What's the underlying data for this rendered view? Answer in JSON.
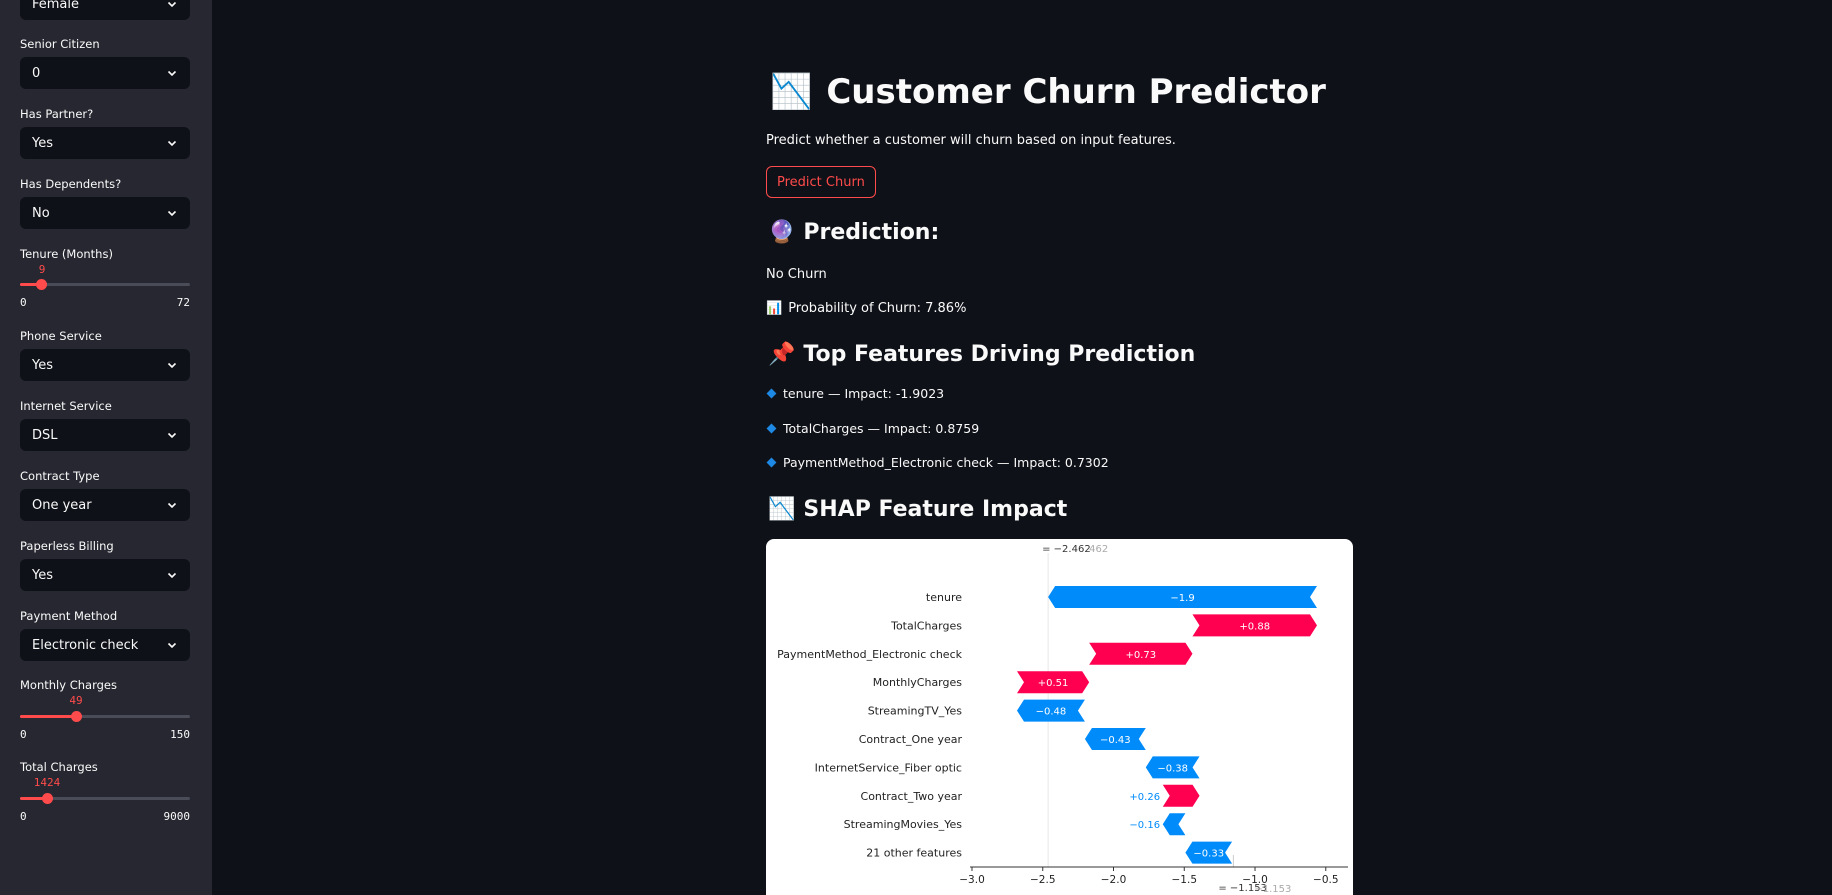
{
  "sidebar": {
    "gender_value": "Female",
    "senior": {
      "label": "Senior Citizen",
      "value": "0"
    },
    "partner": {
      "label": "Has Partner?",
      "value": "Yes"
    },
    "dependents": {
      "label": "Has Dependents?",
      "value": "No"
    },
    "tenure": {
      "label": "Tenure (Months)",
      "value": "9",
      "min": "0",
      "max": "72"
    },
    "phone": {
      "label": "Phone Service",
      "value": "Yes"
    },
    "internet": {
      "label": "Internet Service",
      "value": "DSL"
    },
    "contract": {
      "label": "Contract Type",
      "value": "One year"
    },
    "paperless": {
      "label": "Paperless Billing",
      "value": "Yes"
    },
    "payment": {
      "label": "Payment Method",
      "value": "Electronic check"
    },
    "monthly": {
      "label": "Monthly Charges",
      "value": "49",
      "min": "0",
      "max": "150"
    },
    "total": {
      "label": "Total Charges",
      "value": "1424",
      "min": "0",
      "max": "9000"
    }
  },
  "main": {
    "title_icon": "📉",
    "title": "Customer Churn Predictor",
    "subtitle": "Predict whether a customer will churn based on input features.",
    "predict_button": "Predict Churn",
    "prediction_icon": "🔮",
    "prediction_heading": "Prediction:",
    "prediction_result": "No Churn",
    "probability_icon": "📊",
    "probability_text": "Probability of Churn: 7.86%",
    "features_icon": "📌",
    "features_heading": "Top Features Driving Prediction",
    "top_features": [
      "tenure — Impact: -1.9023",
      "TotalCharges — Impact: 0.8759",
      "PaymentMethod_Electronic check — Impact: 0.7302"
    ],
    "shap_icon": "📉",
    "shap_heading": "SHAP Feature Impact"
  },
  "colors": {
    "accent": "#ff4b4b",
    "shap_negative": "#008bfb",
    "shap_positive": "#ff0051"
  },
  "chart_data": {
    "type": "bar",
    "subtype": "shap-waterfall",
    "categories": [
      "tenure",
      "TotalCharges",
      "PaymentMethod_Electronic check",
      "MonthlyCharges",
      "StreamingTV_Yes",
      "Contract_One year",
      "InternetService_Fiber optic",
      "Contract_Two year",
      "StreamingMovies_Yes",
      "21 other features"
    ],
    "values": [
      -1.9,
      0.88,
      0.73,
      0.51,
      -0.48,
      -0.43,
      -0.38,
      0.26,
      -0.16,
      -0.33
    ],
    "value_labels": [
      "−1.9",
      "+0.88",
      "+0.73",
      "+0.51",
      "−0.48",
      "−0.43",
      "−0.38",
      "+0.26",
      "−0.16",
      "−0.33"
    ],
    "fx_label": "= −2.462",
    "fx_ghost": "462",
    "efx_label": "= −1.153",
    "efx_ghost": "−1.153",
    "fx": -2.462,
    "efx": -1.153,
    "xlim": [
      -3.0,
      -0.35
    ],
    "xticks": [
      -3.0,
      -2.5,
      -2.0,
      -1.5,
      -1.0,
      -0.5
    ],
    "xtick_labels": [
      "−3.0",
      "−2.5",
      "−2.0",
      "−1.5",
      "−1.0",
      "−0.5"
    ]
  }
}
